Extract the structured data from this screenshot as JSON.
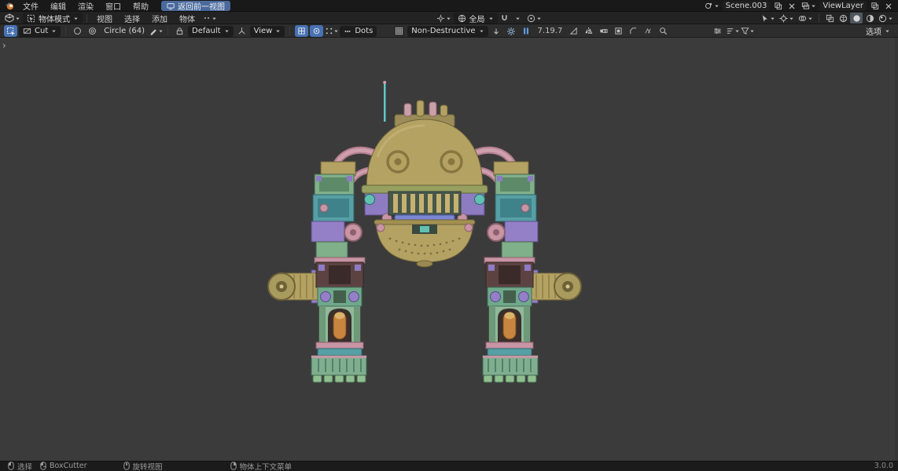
{
  "topbar": {
    "menus": [
      "文件",
      "编辑",
      "渲染",
      "窗口",
      "帮助"
    ],
    "back_button": "返回前一视图",
    "scene_name": "Scene.003",
    "viewlayer_name": "ViewLayer"
  },
  "viewport_header": {
    "mode": "物体模式",
    "menus": [
      "视图",
      "选择",
      "添加",
      "物体"
    ],
    "orientation": "全局"
  },
  "tool_settings": {
    "cut": "Cut",
    "shape": "Circle (64)",
    "collection": "Default",
    "align": "View",
    "dots": "Dots",
    "mode": "Non-Destructive",
    "version": "7.19.7",
    "options": "选项"
  },
  "statusbar": {
    "hints": [
      "选择",
      "BoxCutter",
      "旋转视图",
      "物体上下文菜单"
    ],
    "version": "3.0.0"
  },
  "icons": {
    "logo": "blender-logo",
    "search": "magnifier",
    "settings": "gear",
    "pause": "pause-bars",
    "filter": "funnel",
    "snap": "magnet",
    "orientation": "globe"
  },
  "colors": {
    "accent": "#4772b3",
    "topbar_bg": "#191919",
    "header_bg": "#232323",
    "toolbar_bg": "#2d2d2d",
    "viewport_bg": "#3b3b3b",
    "statusbar_bg": "#1b1b1b",
    "model_tan": "#b4a263",
    "model_green": "#7fb08a",
    "model_teal": "#569fa5",
    "model_purple": "#9480c6",
    "model_pink": "#c795a5"
  }
}
